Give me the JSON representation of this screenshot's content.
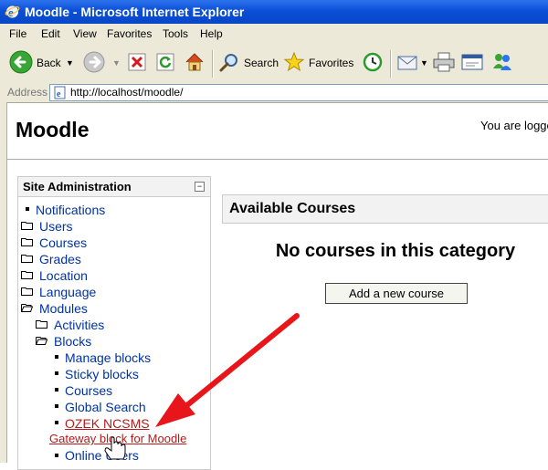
{
  "window": {
    "title": "Moodle - Microsoft Internet Explorer"
  },
  "menu": [
    "File",
    "Edit",
    "View",
    "Favorites",
    "Tools",
    "Help"
  ],
  "toolbar": {
    "back": "Back",
    "search": "Search",
    "favorites": "Favorites"
  },
  "address": {
    "label": "Address",
    "url": "http://localhost/moodle/"
  },
  "page": {
    "title": "Moodle",
    "login_info": "You are logge"
  },
  "admin": {
    "title": "Site Administration",
    "collapse": "−",
    "items": [
      "Notifications",
      "Users",
      "Courses",
      "Grades",
      "Location",
      "Language",
      "Modules",
      "Activities",
      "Blocks",
      "Manage blocks",
      "Sticky blocks",
      "Courses",
      "Global Search",
      "OZEK NCSMS",
      "Gateway block for Moodle",
      "Online Users"
    ]
  },
  "courses": {
    "title": "Available Courses",
    "empty": "No courses in this category",
    "add_button": "Add a new course"
  },
  "colors": {
    "arrow": "#e8161a",
    "titlebar": "#0a4fd6",
    "link": "#0033a0",
    "ozek_link": "#b41b1b"
  }
}
